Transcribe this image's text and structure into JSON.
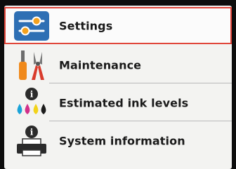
{
  "menu": {
    "items": [
      {
        "label": "Settings",
        "icon": "settings-sliders-icon",
        "selected": true
      },
      {
        "label": "Maintenance",
        "icon": "maintenance-tools-icon",
        "selected": false
      },
      {
        "label": "Estimated ink levels",
        "icon": "ink-levels-icon",
        "selected": false
      },
      {
        "label": "System information",
        "icon": "system-info-printer-icon",
        "selected": false
      }
    ],
    "selection_color": "#e0463a"
  }
}
